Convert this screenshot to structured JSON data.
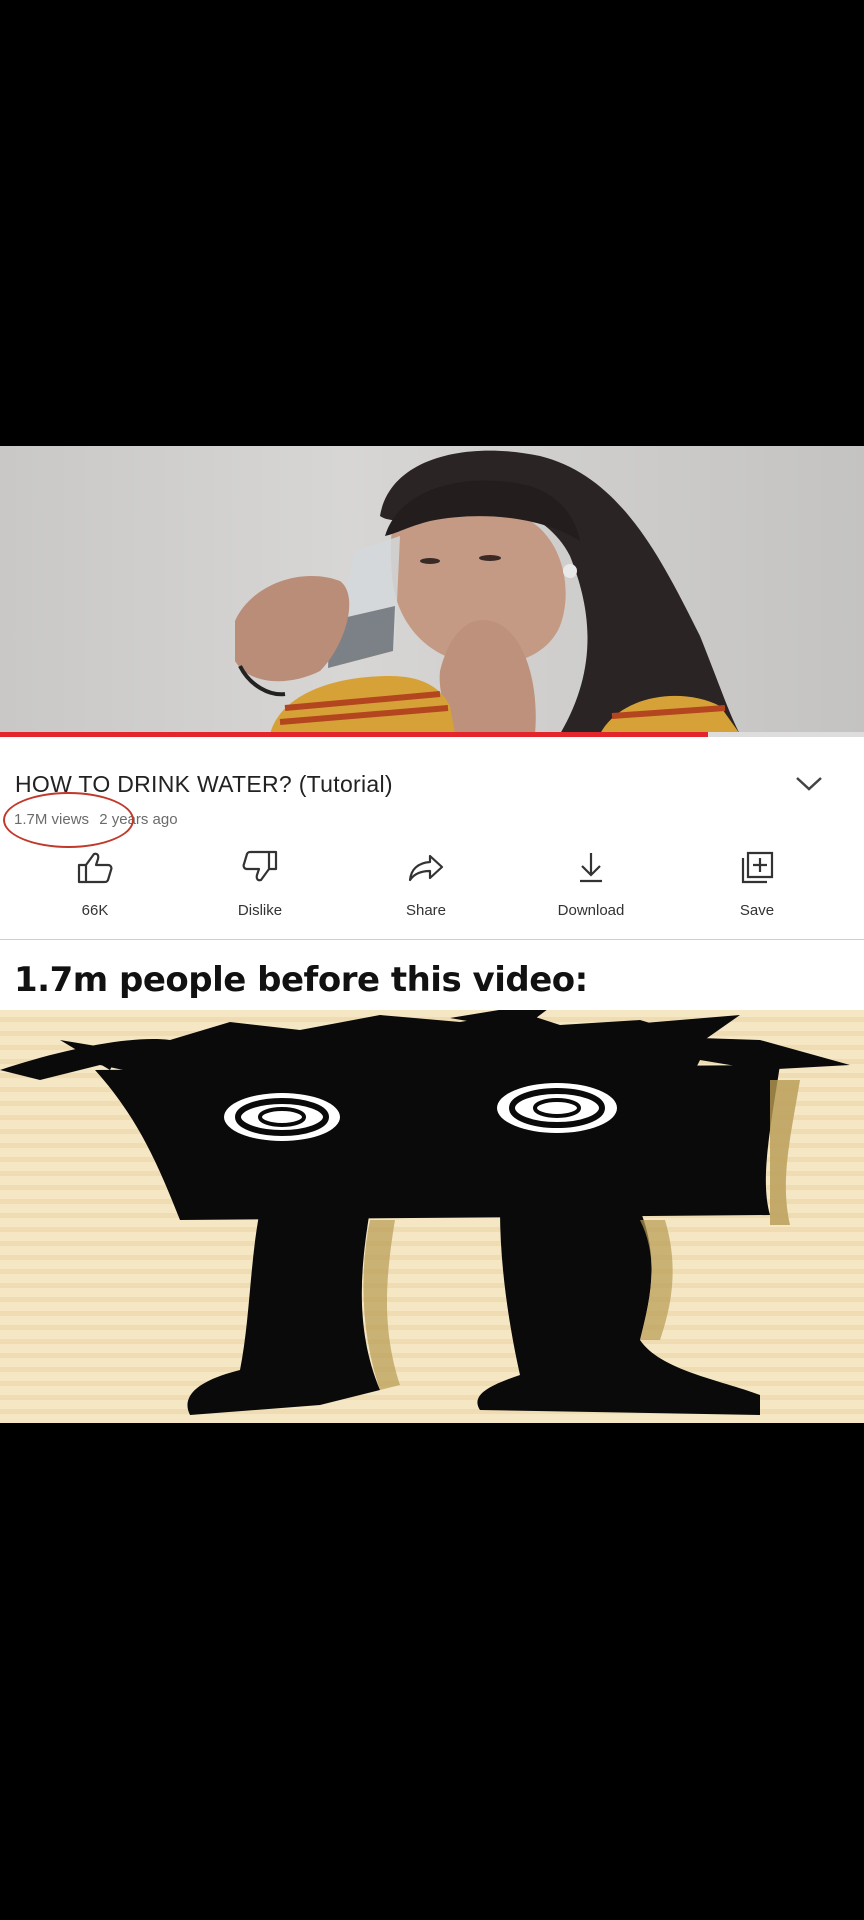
{
  "video": {
    "title": "HOW TO DRINK WATER? (Tutorial)",
    "views": "1.7M views",
    "age": "2 years ago",
    "progress": 0.82
  },
  "actions": [
    {
      "label": "66K",
      "icon": "thumbs-up-icon"
    },
    {
      "label": "Dislike",
      "icon": "thumbs-down-icon"
    },
    {
      "label": "Share",
      "icon": "share-arrow-icon"
    },
    {
      "label": "Download",
      "icon": "download-icon"
    },
    {
      "label": "Save",
      "icon": "save-playlist-icon"
    }
  ],
  "caption": "1.7m people before this video:",
  "colors": {
    "progress_red": "#e3262b",
    "circle_red": "#c0392b",
    "cartoon_background": "#f6e7c4"
  }
}
